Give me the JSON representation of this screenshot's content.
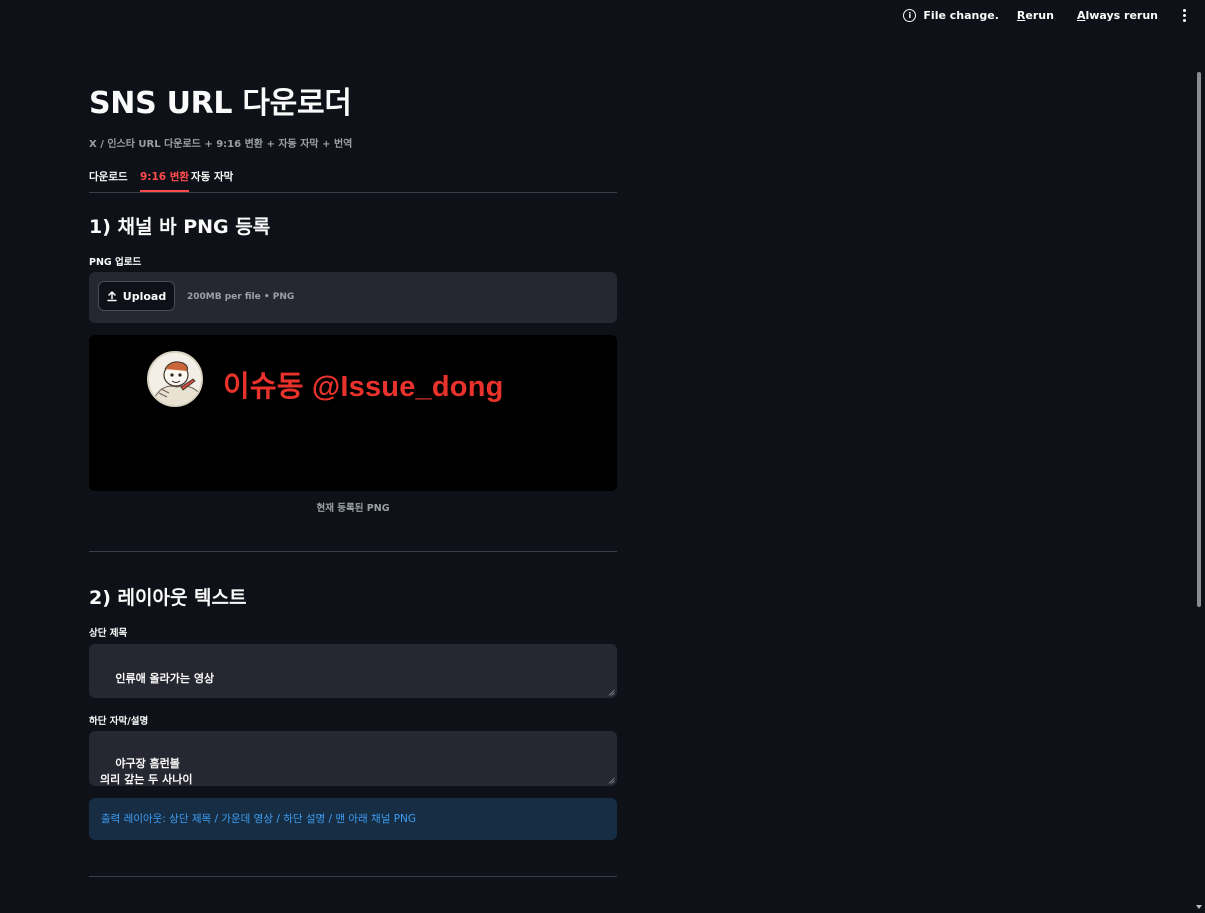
{
  "status_bar": {
    "message": "File change.",
    "rerun_underlined": "R",
    "rerun_rest": "erun",
    "always_underlined": "A",
    "always_rest": "lways rerun"
  },
  "app": {
    "title": "SNS URL 다운로더",
    "subtitle": "X / 인스타 URL 다운로드 + 9:16 변환 + 자동 자막 + 번역",
    "tabs": [
      {
        "label": "다운로드",
        "active": false
      },
      {
        "label": "9:16 변환",
        "active": true
      },
      {
        "label": "자동 자막",
        "active": false
      }
    ],
    "accent_color": "#ff4b4b"
  },
  "section1": {
    "heading": "1) 채널 바 PNG 등록",
    "upload_label": "PNG 업로드",
    "upload_button": "Upload",
    "upload_hint": "200MB per file • PNG",
    "preview_channel_text": "이슈동 @Issue_dong",
    "preview_caption": "현재 등록된 PNG"
  },
  "section2": {
    "heading": "2) 레이아웃 텍스트",
    "top_title_label": "상단 제목",
    "top_title_value": "인류애 올라가는 영상",
    "bottom_caption_label": "하단 자막/설명",
    "bottom_caption_value": "야구장 홈런볼\n의리 갚는 두 사나이",
    "info_text": "출력 레이아웃: 상단 제목 / 가운데 영상 / 하단 설명 / 맨 아래 채널 PNG"
  }
}
